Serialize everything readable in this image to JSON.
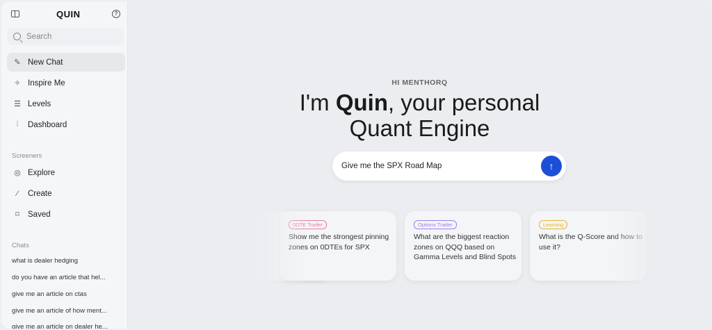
{
  "app": {
    "logo": "QUIN"
  },
  "search": {
    "placeholder": "Search"
  },
  "nav": [
    {
      "label": "New Chat",
      "icon": "edit-icon",
      "active": true
    },
    {
      "label": "Inspire Me",
      "icon": "sparkle-icon"
    },
    {
      "label": "Levels",
      "icon": "menu-icon"
    },
    {
      "label": "Dashboard",
      "icon": "chart-icon"
    }
  ],
  "screeners": {
    "title": "Screeners",
    "items": [
      {
        "label": "Explore",
        "icon": "compass-icon"
      },
      {
        "label": "Create",
        "icon": "wand-icon"
      },
      {
        "label": "Saved",
        "icon": "bookmark-icon"
      }
    ]
  },
  "chats": {
    "title": "Chats",
    "items": [
      "what is dealer hedging",
      "do you have an article that hel...",
      "give me an article on ctas",
      "give me an article of how ment...",
      "give me an article on dealer he..."
    ]
  },
  "main": {
    "greeting": "HI MENTHORQ",
    "headline_pre": "I'm ",
    "headline_brand": "Quin",
    "headline_post": ", your personal",
    "headline_line2": "Quant Engine",
    "prompt_value": "Give me the SPX Road Map",
    "send_icon": "arrow-up-icon"
  },
  "cards": [
    {
      "tag": "0DTE Trader",
      "tag_color": "#e879a9",
      "text": "Show me the strongest pinning zones on 0DTEs for SPX"
    },
    {
      "tag": "Options Trader",
      "tag_color": "#9b7ef0",
      "text": "What are the biggest reaction zones on QQQ based on Gamma Levels and Blind Spots"
    },
    {
      "tag": "Learning",
      "tag_color": "#e8b52a",
      "text": "What is the Q-Score and how to use it?"
    }
  ]
}
